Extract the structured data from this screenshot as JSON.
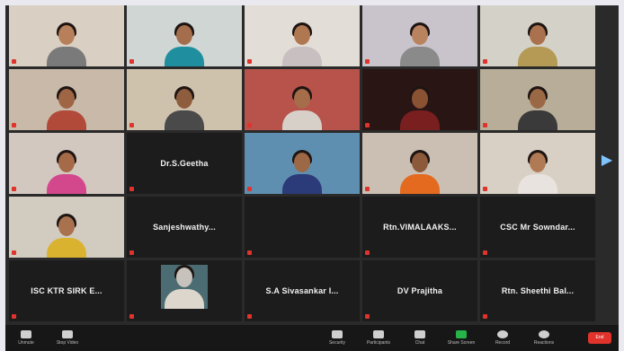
{
  "tiles_row1": [
    {
      "kind": "video",
      "label": "",
      "bg": "#d9cfc2",
      "skin": "#b8805a",
      "shirt": "#7a7a7a"
    },
    {
      "kind": "video",
      "label": "",
      "bg": "#cfd6d4",
      "skin": "#a46d4b",
      "shirt": "#1f8fa0"
    },
    {
      "kind": "video",
      "label": "",
      "bg": "#e2ddd6",
      "skin": "#b07850",
      "shirt": "#c8c0c0"
    },
    {
      "kind": "video",
      "label": "",
      "bg": "#c9c3cc",
      "skin": "#b98360",
      "shirt": "#8a8a8a"
    },
    {
      "kind": "video",
      "label": "",
      "bg": "#d4d2c8",
      "skin": "#a9714d",
      "shirt": "#b59a56"
    }
  ],
  "tiles_row2": [
    {
      "kind": "video",
      "label": "",
      "bg": "#c8b9a8",
      "skin": "#9e6644",
      "shirt": "#b24a3a"
    },
    {
      "kind": "video",
      "label": "",
      "bg": "#cfc2ad",
      "skin": "#8d5d3d",
      "shirt": "#4a4a4a"
    },
    {
      "kind": "video",
      "label": "",
      "bg": "#b8534b",
      "skin": "#a56d49",
      "shirt": "#d7d0c8"
    },
    {
      "kind": "video",
      "label": "",
      "bg": "#2a1515",
      "skin": "#8a5133",
      "shirt": "#7a1f1f"
    },
    {
      "kind": "video",
      "label": "",
      "bg": "#b7ad98",
      "skin": "#9b6846",
      "shirt": "#3a3a3a",
      "active": true
    }
  ],
  "tiles_row3": [
    {
      "kind": "video",
      "label": "",
      "bg": "#d3c8c0",
      "skin": "#a56a47",
      "shirt": "#d3488c"
    },
    {
      "kind": "name",
      "name": "Dr.S.Geetha",
      "label": ""
    },
    {
      "kind": "video",
      "label": "",
      "bg": "#5f8fb0",
      "skin": "#9d6845",
      "shirt": "#2b3a78"
    },
    {
      "kind": "video",
      "label": "",
      "bg": "#cbbfb3",
      "skin": "#8c5a3a",
      "shirt": "#e36a1f"
    },
    {
      "kind": "video",
      "label": "",
      "bg": "#d8d0c4",
      "skin": "#b07a55",
      "shirt": "#e8e3de"
    }
  ],
  "tiles_row4": [
    {
      "kind": "video",
      "label": "",
      "bg": "#d2cbc0",
      "skin": "#a8724e",
      "shirt": "#d9b330"
    },
    {
      "kind": "name",
      "name": "Sanjeshwathy...",
      "label": ""
    },
    {
      "kind": "name",
      "name": "",
      "label": ""
    },
    {
      "kind": "name",
      "name": "Rtn.VIMALAAKS...",
      "label": ""
    },
    {
      "kind": "name",
      "name": "CSC Mr Sowndar...",
      "label": ""
    }
  ],
  "tiles_row5": [
    {
      "kind": "name",
      "name": "ISC KTR SIRK E...",
      "label": ""
    },
    {
      "kind": "video",
      "label": "",
      "bg": "#4c6c73",
      "skin": "#c7c2bb",
      "shirt": "#dcd6cc",
      "small": true
    },
    {
      "kind": "name",
      "name": "S.A Sivasankar I...",
      "label": ""
    },
    {
      "kind": "name",
      "name": "DV Prajitha",
      "label": ""
    },
    {
      "kind": "name",
      "name": "Rtn. Sheethi Bal...",
      "label": ""
    }
  ],
  "toolbar": {
    "items": [
      "Unmute",
      "Stop Video",
      "Security",
      "Participants",
      "Chat",
      "Share Screen",
      "Record",
      "Reactions"
    ],
    "end_label": "End"
  },
  "next_page_icon": "chevron-right-icon"
}
